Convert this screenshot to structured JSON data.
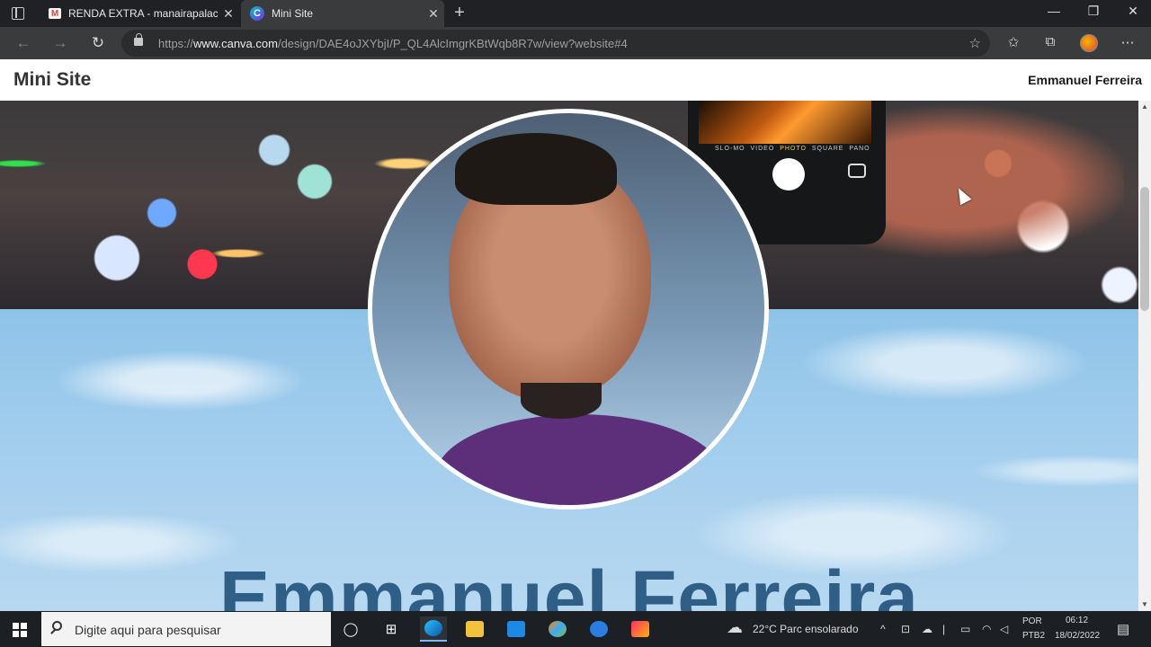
{
  "browser": {
    "tabs": [
      {
        "title": "RENDA EXTRA - manairapalacer",
        "favicon": "gmail-icon",
        "active": false
      },
      {
        "title": "Mini Site",
        "favicon": "canva-icon",
        "active": true
      }
    ],
    "url": {
      "scheme": "https://",
      "host": "www.canva.com",
      "path": "/design/DAE4oJXYbjI/P_QL4AlcImgrKBtWqb8R7w/view?website#4"
    }
  },
  "site": {
    "title": "Mini Site",
    "author": "Emmanuel Ferreira",
    "hero_name": "Emmanuel Ferreira",
    "camera_modes": [
      "SLO-MO",
      "VIDEO",
      "PHOTO",
      "SQUARE",
      "PANO"
    ],
    "selected_mode": "PHOTO"
  },
  "taskbar": {
    "search_placeholder": "Digite aqui para pesquisar",
    "weather": "22°C  Parc ensolarado",
    "language": "POR",
    "keyboard": "PTB2",
    "time": "06:12",
    "date": "18/02/2022"
  },
  "colors": {
    "hero_name": "#2f5f86",
    "taskbar": "#1c1f24",
    "browser_chrome": "#202124"
  }
}
